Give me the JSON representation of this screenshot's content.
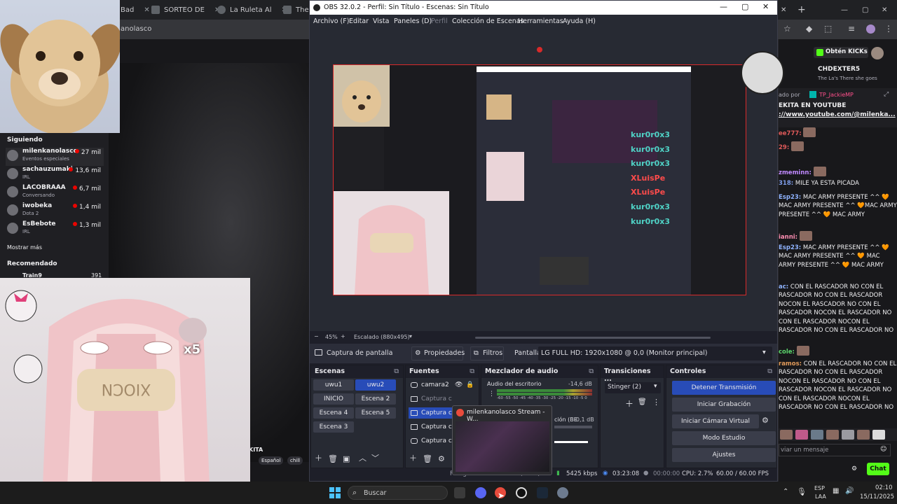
{
  "browser": {
    "tabs": [
      {
        "label": "Bad"
      },
      {
        "label": "SORTEO DE"
      },
      {
        "label": "La Ruleta Al"
      },
      {
        "label": "The b"
      }
    ],
    "address_partial": "anolasco"
  },
  "twitch": {
    "sidebar": {
      "following_header": "Siguiendo",
      "channels": [
        {
          "name": "milenkanolasco",
          "category": "Eventos especiales",
          "viewers": "27 mil"
        },
        {
          "name": "sachauzumaki",
          "category": "IRL",
          "viewers": "13,6 mil"
        },
        {
          "name": "LACOBRAAA",
          "category": "Conversando",
          "viewers": "6,7 mil"
        },
        {
          "name": "iwobeka",
          "category": "Dota 2",
          "viewers": "1,4 mil"
        },
        {
          "name": "EsBebote",
          "category": "IRL",
          "viewers": "1,3 mil"
        }
      ],
      "show_more": "Mostrar más",
      "recommended_header": "Recomendado",
      "recommended_partial": "Train9",
      "recommended_viewers_partial": "391"
    },
    "stream_title_partial": "KITA",
    "tags": [
      "Español",
      "chill"
    ],
    "overlay_multiplier": "x5",
    "chat": {
      "kicks_button": "Obtén KICKs",
      "pinned_user": "CHDEXTER5",
      "pinned_text": "The La's There she goes",
      "pinned_by_prefix": "ado por",
      "pinned_by_user": "TP_JackieMP",
      "link_title": "EKITA EN YOUTUBE",
      "link_url": "://www.youtube.com/@milenka...",
      "messages": [
        {
          "user": "ee777:",
          "text": ""
        },
        {
          "user": "29:",
          "text": ""
        },
        {
          "user": "zmeminn:",
          "text": ""
        },
        {
          "user": "318:",
          "text": "MILE YA ESTA PICADA"
        },
        {
          "user": "Esp23:",
          "text": "MAC ARMY PRESENTE ^^ 🧡MAC ARMY PRESENTE ^^ 🧡MAC ARMY PRESENTE ^^ 🧡 MAC ARMY"
        },
        {
          "user": "ianni:",
          "text": ""
        },
        {
          "user": "Esp23:",
          "text": "MAC ARMY PRESENTE ^^ 🧡MAC ARMY PRESENTE ^^ 🧡 MAC ARMY PRESENTE ^^ 🧡 MAC ARMY"
        },
        {
          "user": "ac:",
          "text": "CON EL RASCADOR NO CON EL RASCADOR NO CON EL RASCADOR NOCON EL RASCADOR NO CON EL RASCADOR NOCON EL RASCADOR NO CON EL RASCADOR NOCON EL RASCADOR NO CON EL RASCADOR NO"
        },
        {
          "user": "cole:",
          "text": ""
        },
        {
          "user": "ramos:",
          "text": "CON EL RASCADOR NO CON EL RASCADOR NO CON EL RASCADOR NOCON EL RASCADOR NO CON EL RASCADOR NOCON EL RASCADOR NO CON EL RASCADOR NOCON EL RASCADOR NO CON EL RASCADOR NO"
        }
      ],
      "input_placeholder": "viar un mensaje",
      "chat_button": "Chat"
    }
  },
  "obs": {
    "title": "OBS 32.0.2 - Perfil: Sin Título - Escenas: Sin Título",
    "menu": [
      "Archivo (F)",
      "Editar",
      "Vista",
      "Paneles (D)",
      "Perfil",
      "Colección de Escenas",
      "Herramientas",
      "Ayuda (H)"
    ],
    "zoom": "45%",
    "scale": "Escalado (880x495)",
    "source_bar": {
      "source_name": "Captura de pantalla",
      "properties": "Propiedades",
      "filters": "Filtros",
      "screen_label": "Pantalla",
      "screen_value": "LG FULL HD: 1920x1080 @ 0,0 (Monitor principal)"
    },
    "scenes": {
      "title": "Escenas",
      "items": [
        "uwu1",
        "uwu2",
        "INICIO",
        "Escena 2",
        "Escena 4",
        "Escena 5",
        "Escena 3"
      ],
      "selected": "uwu2"
    },
    "sources": {
      "title": "Fuentes",
      "items": [
        "camara2",
        "Captura c",
        "Captura c",
        "Captura c",
        "Captura c"
      ]
    },
    "mixer": {
      "title": "Mezclador de audio",
      "track1_name": "Audio del escritorio",
      "track1_db": "-14,6 dB",
      "track2_name_partial": "ción (BE",
      "track2_db": "-0,1 dB",
      "scale_labels": "-60 -55 -50 -45 -40 -35 -30 -25 -20 -15 -10 -5 0"
    },
    "transitions": {
      "title": "Transiciones ...",
      "selected": "Stinger (2)"
    },
    "controls": {
      "title": "Controles",
      "buttons": [
        "Detener Transmisión",
        "Iniciar Grabación",
        "Iniciar Cámara Virtual",
        "Modo Estudio",
        "Ajustes"
      ]
    },
    "status": {
      "bitrate": "5425 kbps",
      "stream_time": "03:23:08",
      "rec_time": "00:00:00",
      "cpu": "CPU: 2.7%",
      "fps": "60.00 / 60.00 FPS",
      "partial_label": "Fotogramas omitidos 0 (0.0%)"
    },
    "preview_chat_names": [
      "kur0r0x3",
      "kur0r0x3",
      "kur0r0x3",
      "XLuisPe",
      "XLuisPe",
      "kur0r0x3",
      "kur0r0x3"
    ]
  },
  "thumbnail": {
    "title": "milenkanolasco Stream - W..."
  },
  "taskbar": {
    "search_placeholder": "Buscar",
    "lang_top": "ESP",
    "lang_bottom": "LAA",
    "time": "02:10",
    "date": "15/11/2025"
  },
  "colors": {
    "twitch_dark": "#18181b",
    "obs_bg": "#272a33",
    "obs_accent": "#284cb8",
    "selection_red": "#d82a2a",
    "live_red": "#eb0400",
    "kick_green": "#53fc18"
  }
}
